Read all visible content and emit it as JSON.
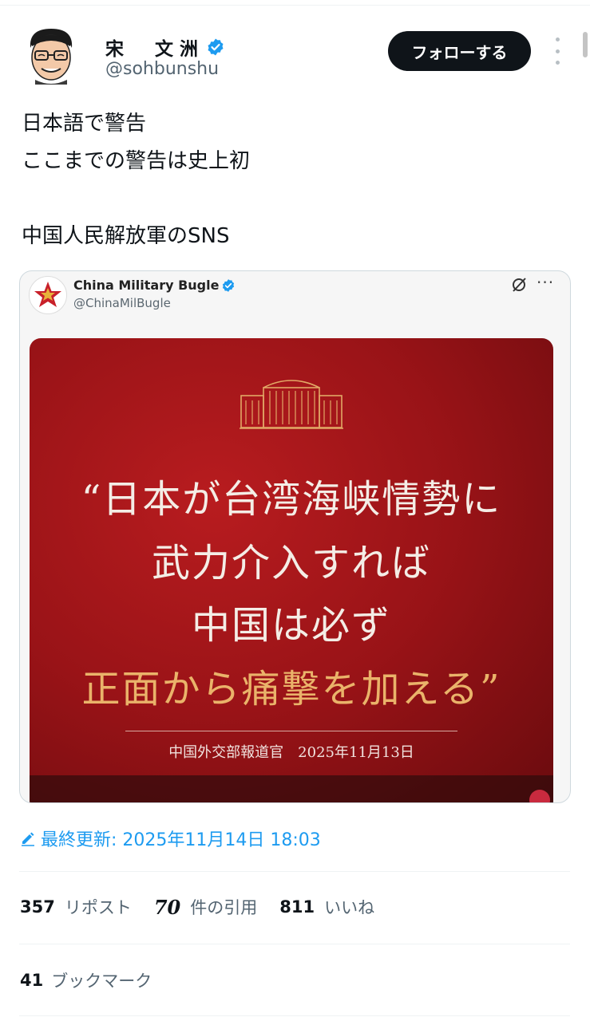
{
  "author": {
    "name": "宋　文洲",
    "handle": "@sohbunshu",
    "follow_label": "フォローする"
  },
  "tweet": {
    "lines": [
      "日本語で警告",
      "ここまでの警告は史上初",
      "",
      "中国人民解放軍のSNS"
    ]
  },
  "quoted": {
    "name": "China Military Bugle",
    "handle": "@ChinaMilBugle",
    "more": "···",
    "poster": {
      "quote_lines": [
        "“日本が台湾海峡情勢に",
        "武力介入すれば",
        "中国は必ず",
        "正面から痛撃を加える”"
      ],
      "attribution": "中国外交部報道官　2025年11月13日"
    }
  },
  "meta": {
    "updated": "最終更新: 2025年11月14日 18:03"
  },
  "stats": {
    "reposts_count": "357",
    "reposts_label": "リポスト",
    "quotes_count": "70",
    "quotes_label": "件の引用",
    "likes_count": "811",
    "likes_label": "いいね",
    "bookmarks_count": "41",
    "bookmarks_label": "ブックマーク"
  },
  "colors": {
    "accent": "#1d9bf0",
    "poster_red": "#991317",
    "poster_gold": "#eab36a",
    "follow_bg": "#0f1419"
  }
}
